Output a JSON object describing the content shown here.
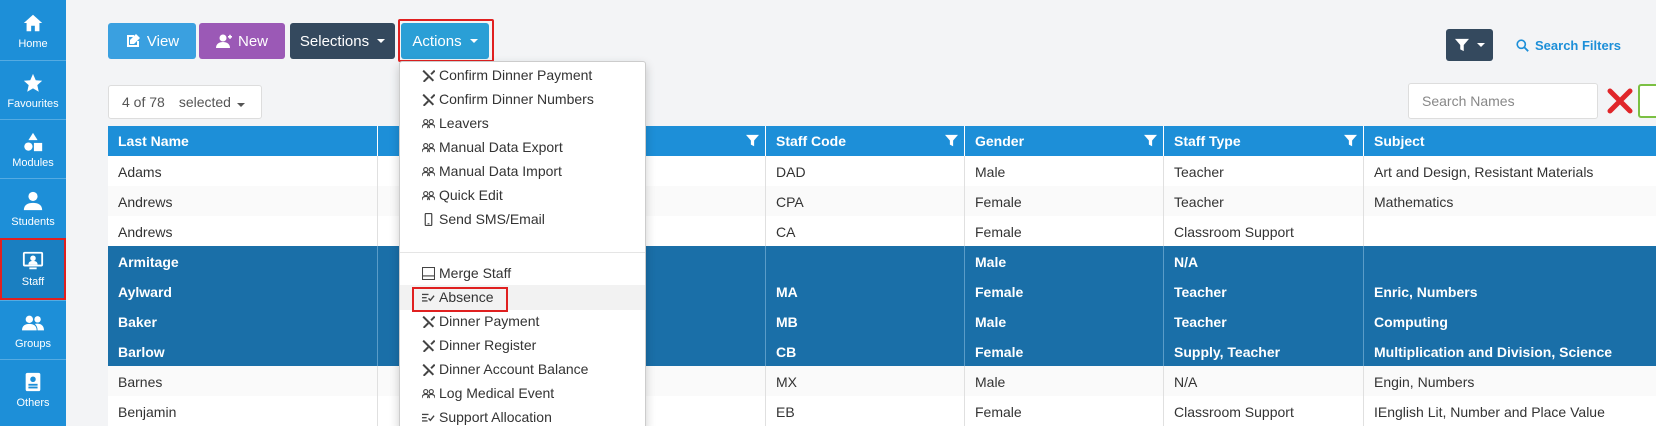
{
  "sidebar": {
    "items": [
      {
        "label": "Home",
        "icon": "home-icon"
      },
      {
        "label": "Favourites",
        "icon": "star-icon"
      },
      {
        "label": "Modules",
        "icon": "modules-icon"
      },
      {
        "label": "Students",
        "icon": "student-icon"
      },
      {
        "label": "Staff",
        "icon": "staff-icon"
      },
      {
        "label": "Groups",
        "icon": "groups-icon"
      },
      {
        "label": "Others",
        "icon": "others-icon"
      }
    ]
  },
  "toolbar": {
    "view_label": "View",
    "new_label": "New",
    "selections_label": "Selections",
    "actions_label": "Actions",
    "search_filters_label": "Search Filters"
  },
  "selection": {
    "count_text": "4 of 78",
    "selected_label": "selected"
  },
  "search": {
    "placeholder": "Search Names"
  },
  "table": {
    "headers": [
      "Last Name",
      "",
      "Staff Code",
      "Gender",
      "Staff Type",
      "Subject"
    ],
    "rows": [
      {
        "last_name": "Adams",
        "staff_code": "DAD",
        "gender": "Male",
        "staff_type": "Teacher",
        "subject": "Art and Design, Resistant Materials",
        "selected": false
      },
      {
        "last_name": "Andrews",
        "staff_code": "CPA",
        "gender": "Female",
        "staff_type": "Teacher",
        "subject": "Mathematics",
        "selected": false
      },
      {
        "last_name": "Andrews",
        "staff_code": "CA",
        "gender": "Female",
        "staff_type": "Classroom Support",
        "subject": "",
        "selected": false
      },
      {
        "last_name": "Armitage",
        "staff_code": "",
        "gender": "Male",
        "staff_type": "N/A",
        "subject": "",
        "selected": true
      },
      {
        "last_name": "Aylward",
        "staff_code": "MA",
        "gender": "Female",
        "staff_type": "Teacher",
        "subject": "Enric, Numbers",
        "selected": true
      },
      {
        "last_name": "Baker",
        "staff_code": "MB",
        "gender": "Male",
        "staff_type": "Teacher",
        "subject": "Computing",
        "selected": true
      },
      {
        "last_name": "Barlow",
        "staff_code": "CB",
        "gender": "Female",
        "staff_type": "Supply, Teacher",
        "subject": "Multiplication and Division, Science",
        "selected": true
      },
      {
        "last_name": "Barnes",
        "staff_code": "MX",
        "gender": "Male",
        "staff_type": "N/A",
        "subject": "Engin, Numbers",
        "selected": false
      },
      {
        "last_name": "Benjamin",
        "staff_code": "EB",
        "gender": "Female",
        "staff_type": "Classroom Support",
        "subject": "IEnglish Lit, Number and Place Value",
        "selected": false
      }
    ]
  },
  "actions_menu": {
    "items": [
      {
        "label": "Confirm Dinner Payment",
        "icon": "cutlery-icon"
      },
      {
        "label": "Confirm Dinner Numbers",
        "icon": "cutlery-icon"
      },
      {
        "label": "Leavers",
        "icon": "people-icon"
      },
      {
        "label": "Manual Data Export",
        "icon": "people-icon"
      },
      {
        "label": "Manual Data Import",
        "icon": "people-icon"
      },
      {
        "label": "Quick Edit",
        "icon": "people-icon"
      },
      {
        "label": "Send SMS/Email",
        "icon": "phone-icon"
      },
      {
        "label": "Merge Staff",
        "icon": "merge-icon"
      },
      {
        "label": "Absence",
        "icon": "absence-icon"
      },
      {
        "label": "Dinner Payment",
        "icon": "cutlery-icon"
      },
      {
        "label": "Dinner Register",
        "icon": "cutlery-icon"
      },
      {
        "label": "Dinner Account Balance",
        "icon": "cutlery-icon"
      },
      {
        "label": "Log Medical Event",
        "icon": "people-icon"
      },
      {
        "label": "Support Allocation",
        "icon": "absence-icon"
      }
    ]
  },
  "colors": {
    "primary": "#1d8fd8",
    "selected_row": "#1a6fa8",
    "highlight": "#e02020",
    "new_button": "#9b59b6",
    "dark_button": "#34495e"
  }
}
